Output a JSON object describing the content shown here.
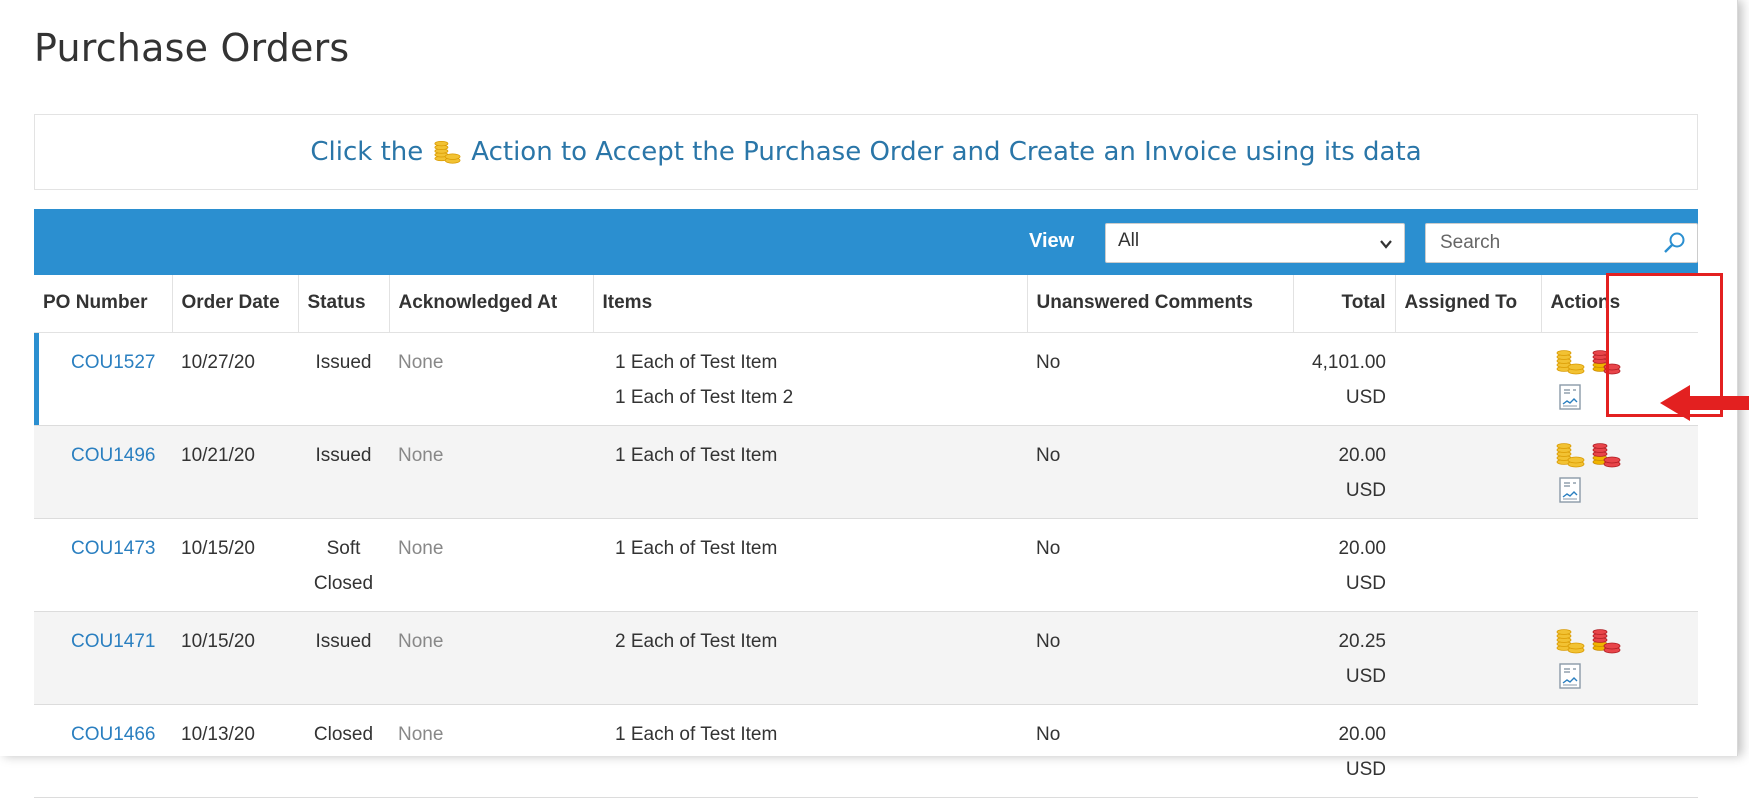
{
  "page": {
    "title": "Purchase Orders"
  },
  "notice": {
    "prefix": "Click the",
    "suffix": "Action to Accept the Purchase Order and Create an Invoice using its data"
  },
  "toolbar": {
    "view_label": "View",
    "view_value": "All",
    "search_placeholder": "Search"
  },
  "table": {
    "columns": [
      "PO Number",
      "Order Date",
      "Status",
      "Acknowledged At",
      "Items",
      "Unanswered Comments",
      "Total",
      "Assigned To",
      "Actions"
    ],
    "rows": [
      {
        "po_number": "COU1527",
        "order_date": "10/27/20",
        "status": "Issued",
        "status_line2": "",
        "acknowledged_at": "None",
        "item_1": "1 Each of Test Item",
        "item_2": "1 Each of Test Item 2",
        "comments": "No",
        "total_amount": "4,101.00",
        "total_currency": "USD",
        "assigned_to": "",
        "actions": [
          "create-invoice-coins-icon",
          "reject-coins-icon",
          "view-document-icon"
        ]
      },
      {
        "po_number": "COU1496",
        "order_date": "10/21/20",
        "status": "Issued",
        "status_line2": "",
        "acknowledged_at": "None",
        "item_1": "1 Each of Test Item",
        "item_2": "",
        "comments": "No",
        "total_amount": "20.00",
        "total_currency": "USD",
        "assigned_to": "",
        "actions": [
          "create-invoice-coins-icon",
          "reject-coins-icon",
          "view-document-icon"
        ]
      },
      {
        "po_number": "COU1473",
        "order_date": "10/15/20",
        "status": "Soft",
        "status_line2": "Closed",
        "acknowledged_at": "None",
        "item_1": "1 Each of Test Item",
        "item_2": "",
        "comments": "No",
        "total_amount": "20.00",
        "total_currency": "USD",
        "assigned_to": "",
        "actions": []
      },
      {
        "po_number": "COU1471",
        "order_date": "10/15/20",
        "status": "Issued",
        "status_line2": "",
        "acknowledged_at": "None",
        "item_1": "2 Each of Test Item",
        "item_2": "",
        "comments": "No",
        "total_amount": "20.25",
        "total_currency": "USD",
        "assigned_to": "",
        "actions": [
          "create-invoice-coins-icon",
          "reject-coins-icon",
          "view-document-icon"
        ]
      },
      {
        "po_number": "COU1466",
        "order_date": "10/13/20",
        "status": "Closed",
        "status_line2": "",
        "acknowledged_at": "None",
        "item_1": "1 Each of Test Item",
        "item_2": "",
        "comments": "No",
        "total_amount": "20.00",
        "total_currency": "USD",
        "assigned_to": "",
        "actions": []
      }
    ]
  },
  "colors": {
    "toolbar_blue": "#2b8fd0",
    "link_blue": "#2a7fc0",
    "notice_text": "#2a76a8",
    "highlight_red": "#e32020",
    "coin_gold": "#f0b400",
    "coin_red": "#d9262c"
  }
}
